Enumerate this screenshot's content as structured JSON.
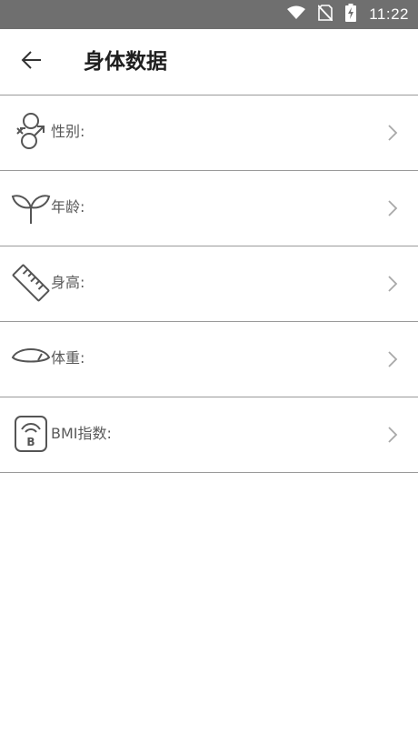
{
  "status_bar": {
    "time": "11:22",
    "icons": [
      "wifi-icon",
      "no-sim-icon",
      "battery-charging-icon"
    ]
  },
  "toolbar": {
    "back_icon": "arrow-left-icon",
    "title": "身体数据"
  },
  "items": [
    {
      "label": "性别:",
      "icon": "gender-icon"
    },
    {
      "label": "年龄:",
      "icon": "sprout-icon"
    },
    {
      "label": "身高:",
      "icon": "ruler-icon"
    },
    {
      "label": "体重:",
      "icon": "scale-icon"
    },
    {
      "label": "BMI指数:",
      "icon": "bmi-icon"
    }
  ],
  "colors": {
    "status_bar": "#6f6f6f",
    "divider": "#9a9a9a",
    "label": "#595959",
    "chevron": "#a8a8a8",
    "icon": "#555555"
  }
}
